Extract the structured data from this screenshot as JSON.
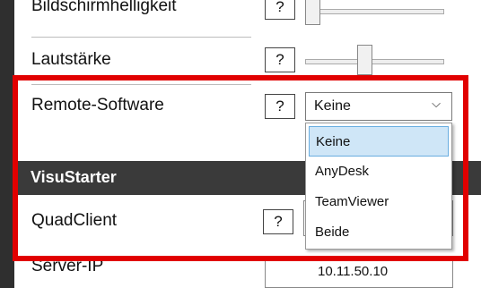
{
  "settings": {
    "brightness_label": "Bildschirmhelligkeit",
    "volume_label": "Lautstärke",
    "remote_label": "Remote-Software",
    "help_label": "?",
    "brightness_value": 0.05,
    "volume_value": 0.45
  },
  "remote_select": {
    "value": "Keine",
    "options": [
      "Keine",
      "AnyDesk",
      "TeamViewer",
      "Beide"
    ]
  },
  "visustarter": {
    "section_title": "VisuStarter",
    "quadclient_label": "QuadClient",
    "server_ip_label": "Server-IP",
    "server_ip_value": "10.11.50.10"
  },
  "colors": {
    "highlight": "#e10000",
    "selected_option": "#cfe6f7",
    "section_bar": "#3a3a3a"
  }
}
